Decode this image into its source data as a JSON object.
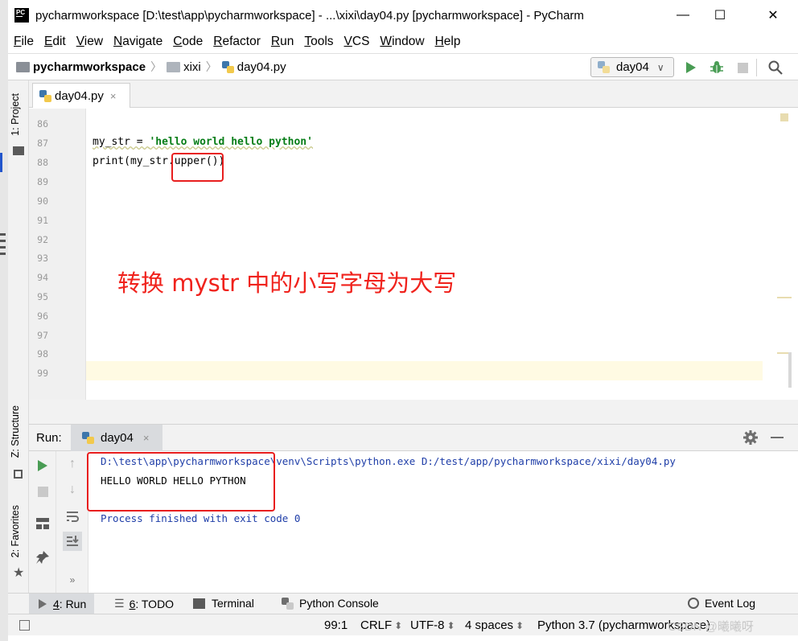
{
  "window": {
    "title": "pycharmworkspace [D:\\test\\app\\pycharmworkspace] - ...\\xixi\\day04.py [pycharmworkspace] - PyCharm",
    "app_icon_text": "PC",
    "minimize": "—",
    "maximize": "☐",
    "close": "✕"
  },
  "menu": {
    "items": [
      {
        "u": "F",
        "rest": "ile"
      },
      {
        "u": "E",
        "rest": "dit"
      },
      {
        "u": "V",
        "rest": "iew"
      },
      {
        "u": "N",
        "rest": "avigate"
      },
      {
        "u": "C",
        "rest": "ode"
      },
      {
        "u": "R",
        "rest": "efactor"
      },
      {
        "u": "R",
        "rest": "un"
      },
      {
        "u": "T",
        "rest": "ools"
      },
      {
        "u": "V",
        "rest": "CS"
      },
      {
        "u": "W",
        "rest": "indow"
      },
      {
        "u": "H",
        "rest": "elp"
      }
    ]
  },
  "navbar": {
    "crumbs": [
      "pycharmworkspace",
      "xixi",
      "day04.py"
    ],
    "run_config": "day04",
    "run_config_arrow": "∨"
  },
  "left_strip": {
    "project": "1: Project",
    "structure": "Z: Structure",
    "favorites": "2: Favorites"
  },
  "editor": {
    "tab_label": "day04.py",
    "tab_close": "×",
    "line_numbers": [
      "86",
      "87",
      "88",
      "89",
      "90",
      "91",
      "92",
      "93",
      "94",
      "95",
      "96",
      "97",
      "98",
      "99"
    ],
    "code": {
      "line87_var": "my_str = ",
      "line87_str": "'hello world hello python'",
      "line88_pre": "print(my_str.",
      "line88_method": "upper",
      "line88_post": "())"
    },
    "annotation": "转换 mystr 中的小写字母为大写"
  },
  "run_panel": {
    "label": "Run:",
    "tab": "day04",
    "tab_close": "×",
    "console": {
      "command": "D:\\test\\app\\pycharmworkspace\\venv\\Scripts\\python.exe D:/test/app/pycharmworkspace/xixi/day04.py",
      "output": "HELLO WORLD HELLO PYTHON",
      "finished": "Process finished with exit code 0"
    }
  },
  "bottom_tabs": {
    "run": {
      "u": "4",
      "rest": ": Run"
    },
    "todo": {
      "u": "6",
      "rest": ": TODO"
    },
    "terminal": "Terminal",
    "python_console": "Python Console",
    "event_log": "Event Log"
  },
  "status": {
    "position": "99:1",
    "line_sep": "CRLF",
    "encoding": "UTF-8",
    "indent": "4 spaces",
    "interpreter": "Python 3.7 (pycharmworkspace)",
    "watermark": "CSDN @曦曦呀"
  },
  "colors": {
    "annotation_red": "#f0221c",
    "run_green": "#499c54",
    "string_green": "#067d17",
    "console_blue": "#1f3ea8",
    "current_line": "#fffae3"
  }
}
